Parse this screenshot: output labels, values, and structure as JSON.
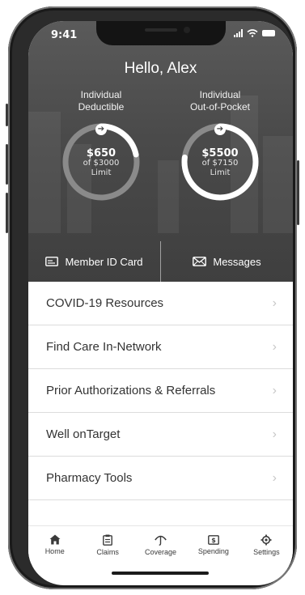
{
  "status_bar": {
    "time": "9:41"
  },
  "greeting": "Hello, Alex",
  "meters": [
    {
      "title_line1": "Individual",
      "title_line2": "Deductible",
      "amount": "$650",
      "of_line": "of $3000",
      "limit_label": "Limit",
      "spent": 650,
      "total": 3000
    },
    {
      "title_line1": "Individual",
      "title_line2": "Out-of-Pocket",
      "amount": "$5500",
      "of_line": "of $7150",
      "limit_label": "Limit",
      "spent": 5500,
      "total": 7150
    }
  ],
  "quick_actions": {
    "member_id": "Member ID Card",
    "messages": "Messages"
  },
  "menu": [
    "COVID-19 Resources",
    "Find Care In-Network",
    "Prior Authorizations & Referrals",
    "Well onTarget",
    "Pharmacy Tools"
  ],
  "tabs": {
    "home": "Home",
    "claims": "Claims",
    "coverage": "Coverage",
    "spending": "Spending",
    "settings": "Settings"
  },
  "icons": {
    "chevron": "chevron-right-icon",
    "arrow": "arrow-right-icon"
  },
  "colors": {
    "hero_bg": "#4a4a4a",
    "ring_track": "#8a8a8a",
    "ring_fill": "#ffffff",
    "text_dark": "#333333"
  }
}
